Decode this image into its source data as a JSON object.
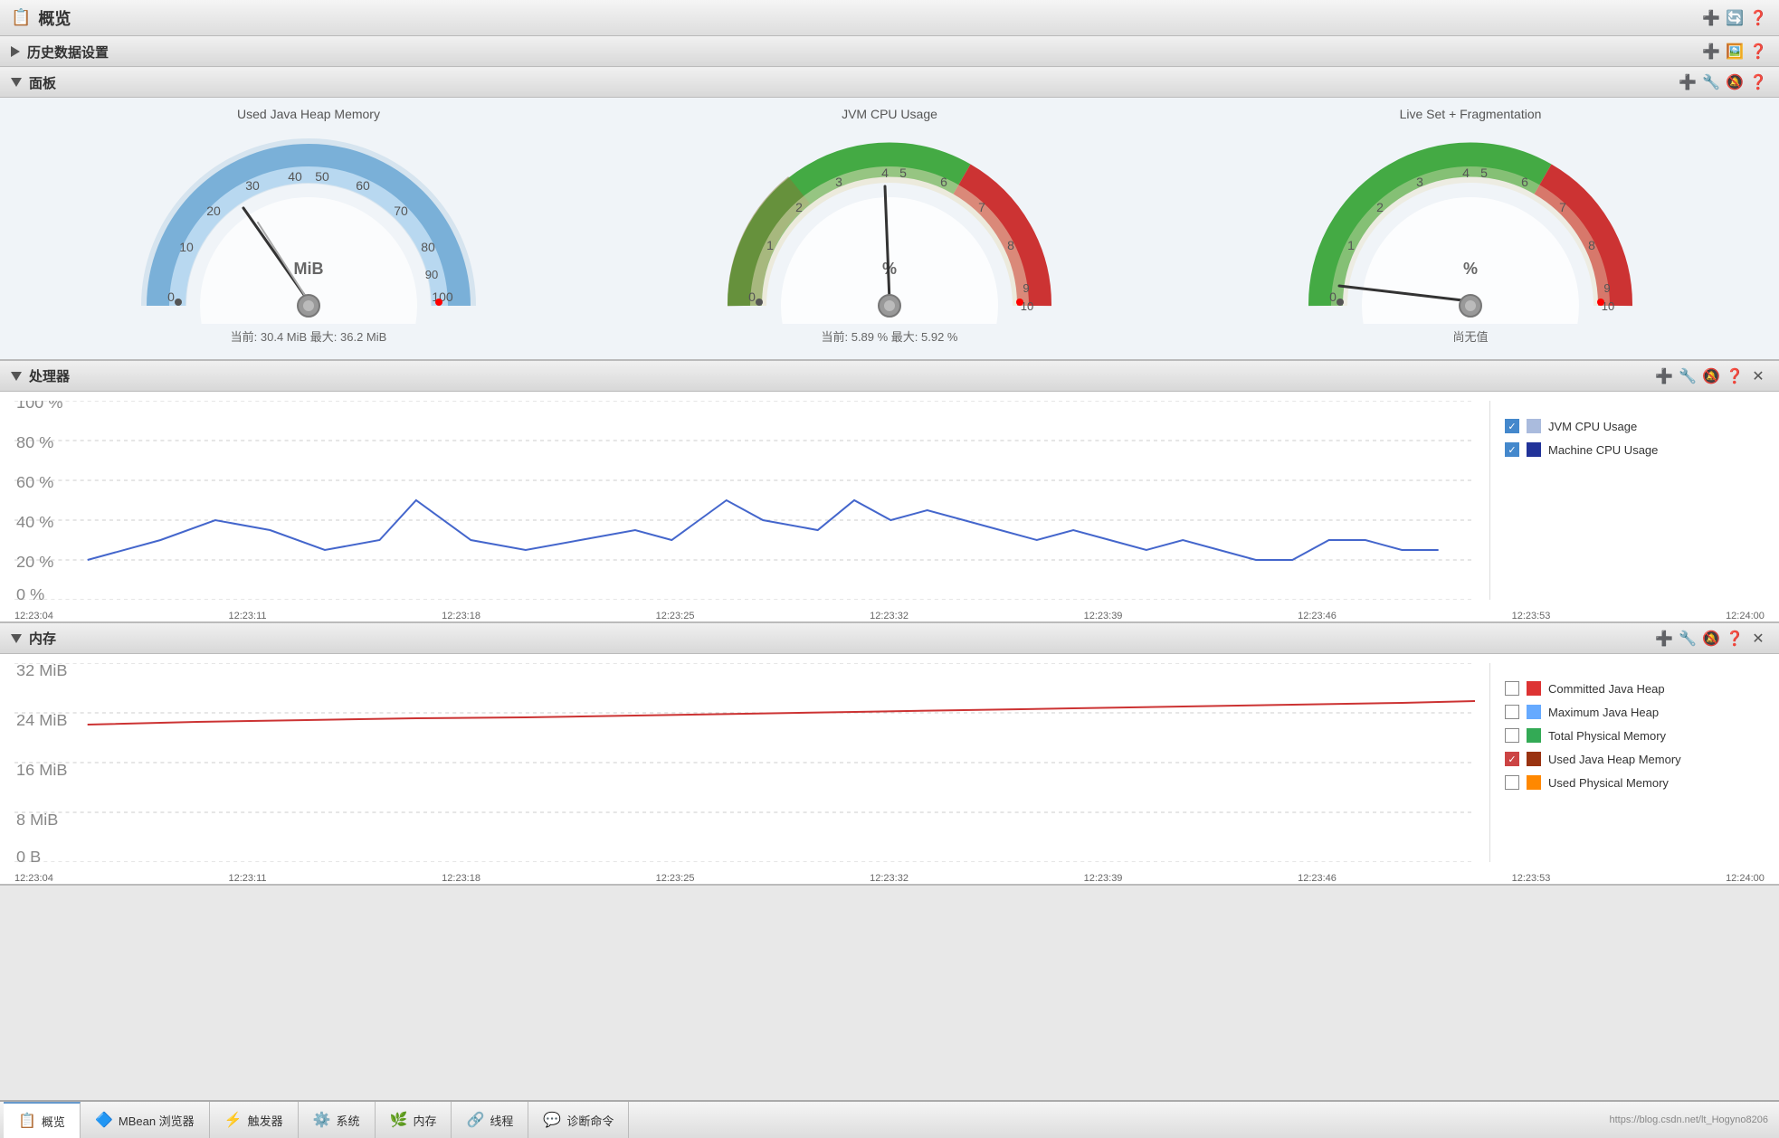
{
  "header": {
    "title": "概览",
    "icon": "📋"
  },
  "history_section": {
    "label": "历史数据设置",
    "collapsed": true
  },
  "panel_section": {
    "label": "面板",
    "collapsed": false,
    "gauges": [
      {
        "title": "Used Java Heap Memory",
        "subtitle": "当前: 30.4 MiB  最大: 36.2 MiB",
        "unit": "MiB",
        "value": 30.4,
        "max": 100,
        "needle_angle": -60
      },
      {
        "title": "JVM CPU Usage",
        "subtitle": "当前: 5.89 %  最大: 5.92 %",
        "unit": "%",
        "value": 5.89,
        "max": 10,
        "needle_angle": -15
      },
      {
        "title": "Live Set + Fragmentation",
        "subtitle": "尚无值",
        "unit": "%",
        "value": 0,
        "max": 10,
        "needle_angle": -90
      }
    ]
  },
  "processor_section": {
    "label": "处理器",
    "y_labels": [
      "100 %",
      "80 %",
      "60 %",
      "40 %",
      "20 %",
      "0 %"
    ],
    "x_labels": [
      "12:23:04",
      "12:23:11",
      "12:23:18",
      "12:23:25",
      "12:23:32",
      "12:23:39",
      "12:23:46",
      "12:23:53",
      "12:24:00"
    ],
    "legend": [
      {
        "label": "JVM CPU Usage",
        "color": "#aabbdd",
        "checked": true
      },
      {
        "label": "Machine CPU Usage",
        "color": "#223399",
        "checked": true
      }
    ]
  },
  "memory_section": {
    "label": "内存",
    "y_labels": [
      "32 MiB",
      "24 MiB",
      "16 MiB",
      "8 MiB",
      "0 B"
    ],
    "x_labels": [
      "12:23:04",
      "12:23:11",
      "12:23:18",
      "12:23:25",
      "12:23:32",
      "12:23:39",
      "12:23:46",
      "12:23:53",
      "12:24:00"
    ],
    "legend": [
      {
        "label": "Committed Java Heap",
        "color": "#dd3333",
        "checked": false
      },
      {
        "label": "Maximum Java Heap",
        "color": "#66aaff",
        "checked": false
      },
      {
        "label": "Total Physical Memory",
        "color": "#33aa55",
        "checked": false
      },
      {
        "label": "Used Java Heap Memory",
        "color": "#993311",
        "checked": true
      },
      {
        "label": "Used Physical Memory",
        "color": "#ff8800",
        "checked": false
      }
    ]
  },
  "tabs": [
    {
      "label": "概览",
      "icon": "📋",
      "active": true
    },
    {
      "label": "MBean 浏览器",
      "icon": "🔷",
      "active": false
    },
    {
      "label": "触发器",
      "icon": "⚡",
      "active": false
    },
    {
      "label": "系统",
      "icon": "⚙️",
      "active": false
    },
    {
      "label": "内存",
      "icon": "🌿",
      "active": false
    },
    {
      "label": "线程",
      "icon": "🔗",
      "active": false
    },
    {
      "label": "诊断命令",
      "icon": "💬",
      "active": false
    }
  ],
  "status_url": "https://blog.csdn.net/lt_Hogyno8206"
}
